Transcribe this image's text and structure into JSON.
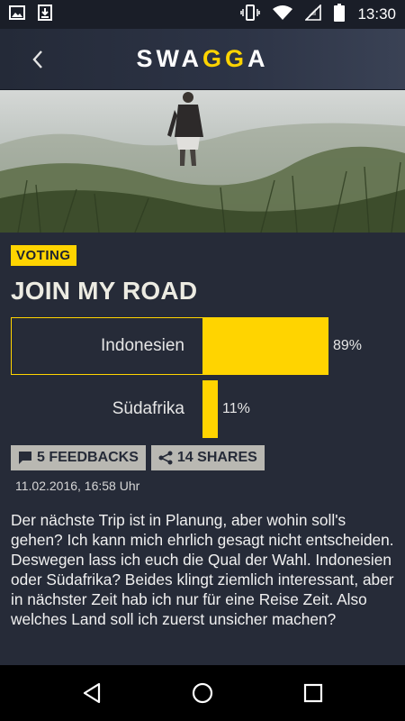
{
  "status_bar": {
    "time": "13:30",
    "icons": [
      "image-icon",
      "download-icon",
      "vibrate-icon",
      "wifi-icon",
      "signal-icon",
      "battery-icon"
    ]
  },
  "header": {
    "back_icon": "chevron-left-icon",
    "logo_text": "SWAGGA"
  },
  "hero": {
    "image": "man-walking-in-foggy-grass"
  },
  "post": {
    "badge": "VOTING",
    "title": "JOIN MY ROAD",
    "options": [
      {
        "label": "Indonesien",
        "percent": 89,
        "percent_text": "89%",
        "selected": true
      },
      {
        "label": "Südafrika",
        "percent": 11,
        "percent_text": "11%",
        "selected": false
      }
    ],
    "feedbacks_label": "5 FEEDBACKS",
    "shares_label": "14 SHARES",
    "date": "11.02.2016, 16:58 Uhr",
    "text": "Der nächste Trip ist in Planung, aber wohin soll's gehen? Ich kann mich ehrlich gesagt nicht entscheiden. Deswegen lass ich euch die Qual der Wahl. Indonesien oder Südafrika? Beides klingt ziemlich interessant, aber in nächster Zeit hab ich nur für eine Reise Zeit. Also welches Land soll ich zuerst unsicher machen?"
  },
  "colors": {
    "accent": "#ffd400",
    "background": "#262b38",
    "button_bg": "#b9b8b2"
  },
  "navigation": [
    "back-nav-icon",
    "home-nav-icon",
    "recents-nav-icon"
  ]
}
